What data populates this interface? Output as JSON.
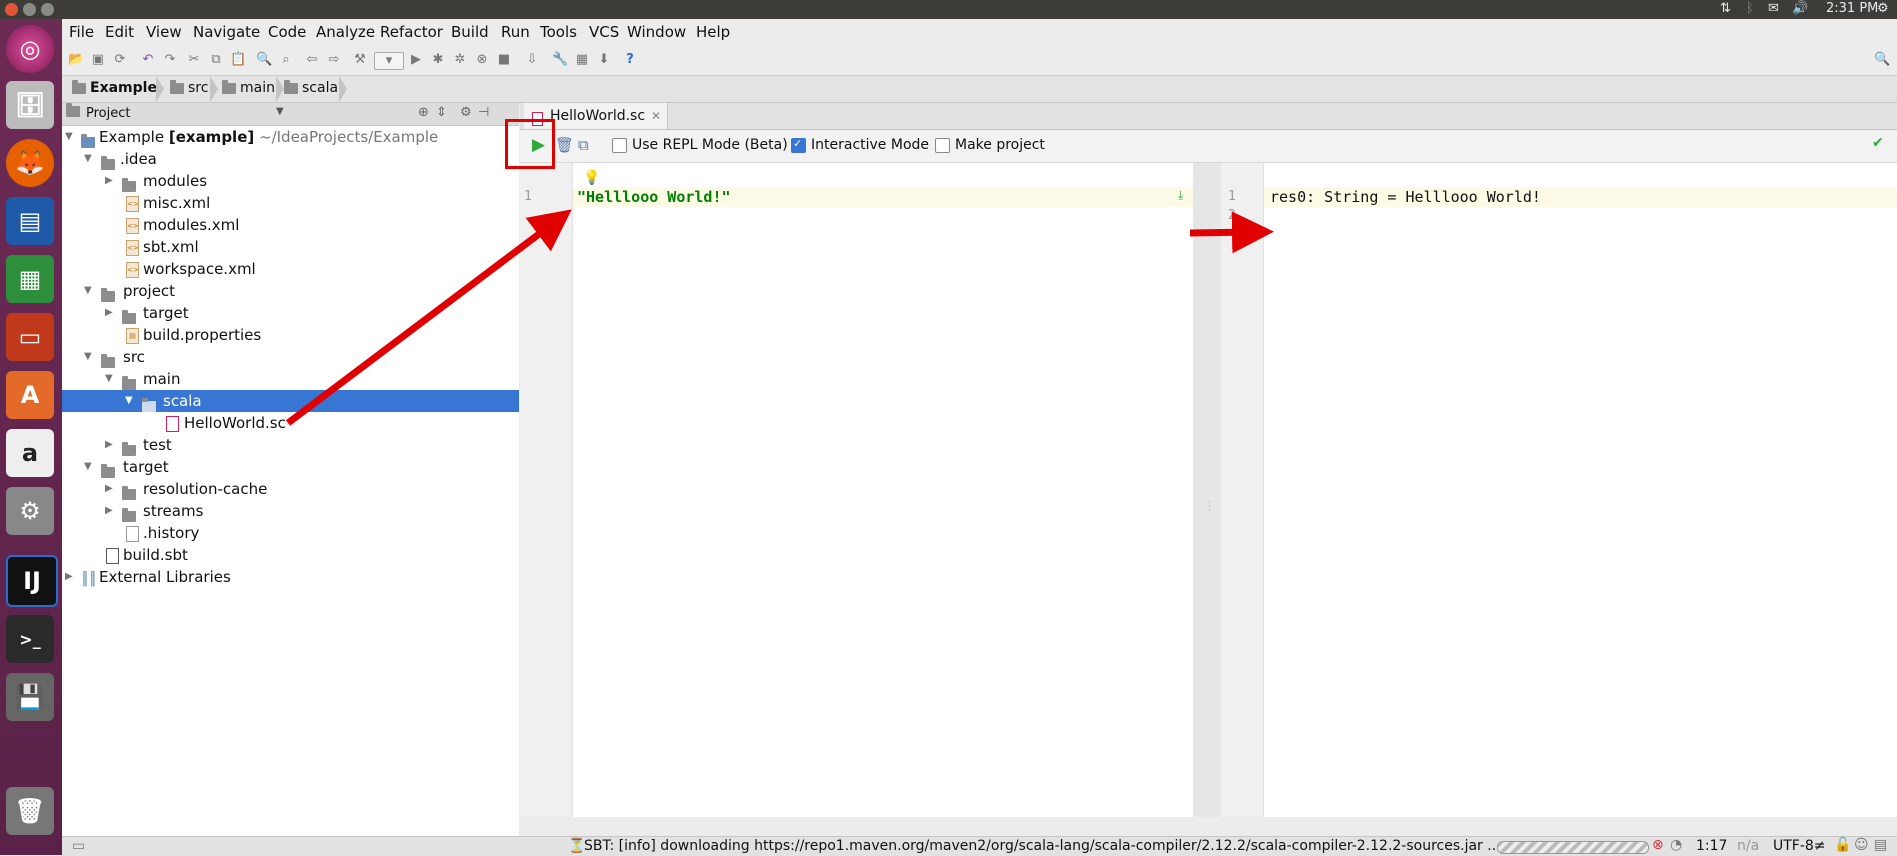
{
  "system": {
    "time": "2:31 PM"
  },
  "menubar": [
    "File",
    "Edit",
    "View",
    "Navigate",
    "Code",
    "Analyze",
    "Refactor",
    "Build",
    "Run",
    "Tools",
    "VCS",
    "Window",
    "Help"
  ],
  "breadcrumbs": [
    "Example",
    "src",
    "main",
    "scala"
  ],
  "project_panel": {
    "title": "Project",
    "root_name": "Example",
    "root_module": "[example]",
    "root_path": "~/IdeaProjects/Example",
    "items": [
      ".idea",
      "modules",
      "misc.xml",
      "modules.xml",
      "sbt.xml",
      "workspace.xml",
      "project",
      "target",
      "build.properties",
      "src",
      "main",
      "scala",
      "HelloWorld.sc",
      "test",
      "target",
      "resolution-cache",
      "streams",
      ".history",
      "build.sbt",
      "External Libraries"
    ]
  },
  "editor": {
    "tab_label": "HelloWorld.sc",
    "options": {
      "repl_label": "Use REPL Mode (Beta)",
      "repl_checked": false,
      "interactive_label": "Interactive Mode",
      "interactive_checked": true,
      "make_label": "Make project",
      "make_checked": false
    },
    "code_lines": [
      "\"Helllooo World!\""
    ],
    "code_line_numbers": [
      "1"
    ],
    "output_lines": [
      "res0: String = Helllooo World!",
      ""
    ],
    "output_line_numbers": [
      "1",
      "2"
    ]
  },
  "statusbar": {
    "message": "SBT: [info] downloading https://repo1.maven.org/maven2/org/scala-lang/scala-compiler/2.12.2/scala-compiler-2.12.2-sources.jar ...",
    "position": "1:17",
    "na": "n/a",
    "encoding": "UTF-8≠"
  },
  "colors": {
    "launcher": "#5a2248",
    "selection": "#3876d4",
    "string": "#008000",
    "annotation": "#e00000"
  }
}
